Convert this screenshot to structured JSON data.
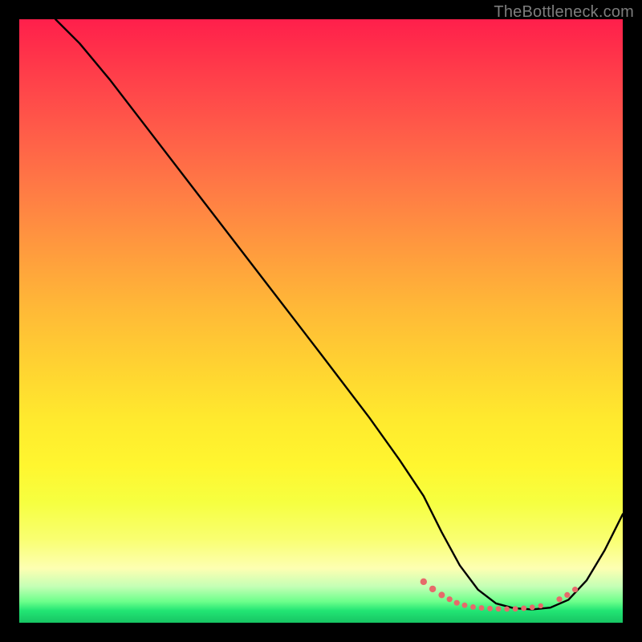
{
  "watermark": "TheBottleneck.com",
  "chart_data": {
    "type": "line",
    "title": "",
    "xlabel": "",
    "ylabel": "",
    "xlim": [
      0,
      100
    ],
    "ylim": [
      0,
      100
    ],
    "series": [
      {
        "name": "curve",
        "x": [
          6,
          10,
          15,
          20,
          30,
          40,
          50,
          58,
          63,
          67,
          70,
          73,
          76,
          79,
          82,
          85,
          88,
          91,
          94,
          97,
          100
        ],
        "y": [
          100,
          96,
          90,
          83.5,
          70.5,
          57.5,
          44.5,
          34,
          27,
          21,
          15,
          9.5,
          5.5,
          3.2,
          2.4,
          2.2,
          2.5,
          3.8,
          7,
          12,
          18
        ]
      }
    ],
    "markers": {
      "name": "valley-dots",
      "color": "#e66a6a",
      "points": [
        {
          "x": 67,
          "y": 6.8,
          "r": 4.2
        },
        {
          "x": 68.5,
          "y": 5.6,
          "r": 4.2
        },
        {
          "x": 70,
          "y": 4.6,
          "r": 4.0
        },
        {
          "x": 71.3,
          "y": 3.9,
          "r": 3.6
        },
        {
          "x": 72.5,
          "y": 3.3,
          "r": 3.6
        },
        {
          "x": 73.8,
          "y": 2.9,
          "r": 3.4
        },
        {
          "x": 75.2,
          "y": 2.6,
          "r": 3.4
        },
        {
          "x": 76.6,
          "y": 2.45,
          "r": 3.4
        },
        {
          "x": 78.0,
          "y": 2.35,
          "r": 3.4
        },
        {
          "x": 79.4,
          "y": 2.3,
          "r": 3.4
        },
        {
          "x": 80.8,
          "y": 2.28,
          "r": 3.4
        },
        {
          "x": 82.2,
          "y": 2.3,
          "r": 3.4
        },
        {
          "x": 83.6,
          "y": 2.4,
          "r": 3.4
        },
        {
          "x": 85.0,
          "y": 2.55,
          "r": 3.4
        },
        {
          "x": 86.4,
          "y": 2.8,
          "r": 3.2
        },
        {
          "x": 89.5,
          "y": 3.9,
          "r": 3.6
        },
        {
          "x": 90.8,
          "y": 4.6,
          "r": 3.6
        },
        {
          "x": 92.1,
          "y": 5.5,
          "r": 3.6
        }
      ]
    }
  }
}
